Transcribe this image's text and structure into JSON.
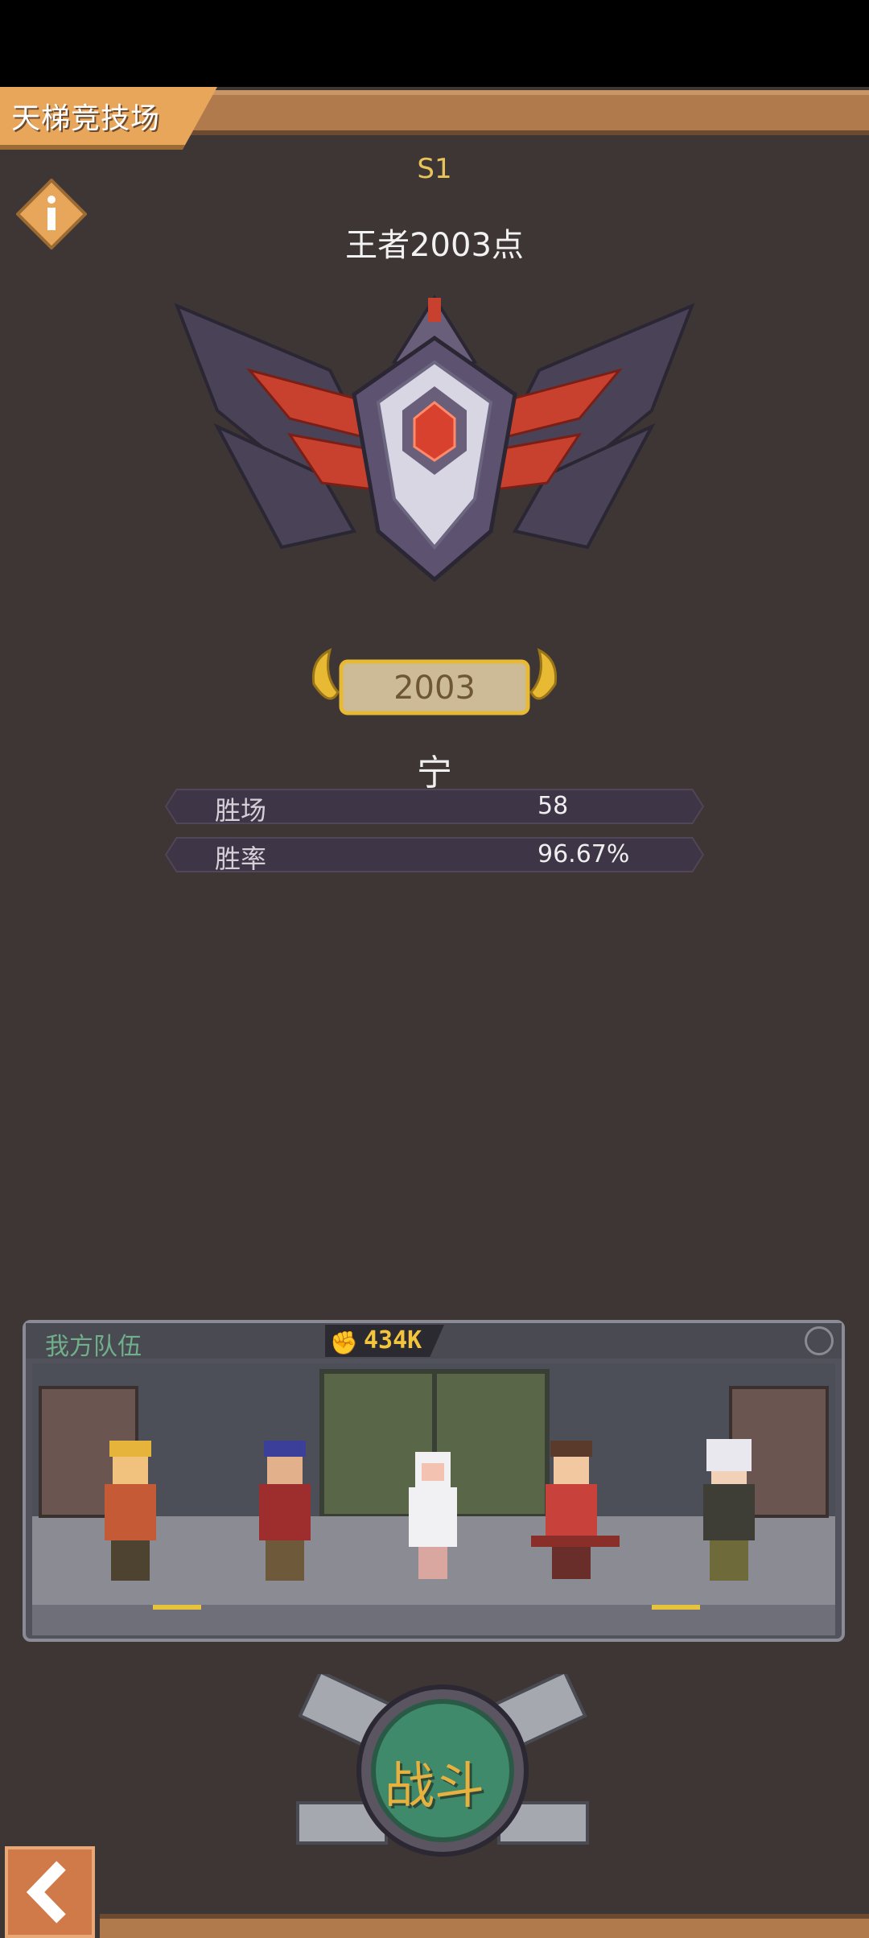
{
  "header": {
    "title": "天梯竞技场"
  },
  "season": "S1",
  "rank": {
    "name": "王者2003点",
    "score": "2003"
  },
  "player": {
    "name": "宁"
  },
  "stats": [
    {
      "label": "胜场",
      "value": "58"
    },
    {
      "label": "胜率",
      "value": "96.67%"
    }
  ],
  "team": {
    "label": "我方队伍",
    "power": "434K"
  },
  "actions": {
    "fight": "战斗"
  },
  "colors": {
    "accent": "#e7a65a",
    "gold": "#e8c35a",
    "panel": "#3e3546",
    "fight_green": "#3f8a6a"
  },
  "icons": {
    "info": "info-icon",
    "back": "back-arrow-icon",
    "power": "fist-icon",
    "settings": "settings-icon"
  }
}
